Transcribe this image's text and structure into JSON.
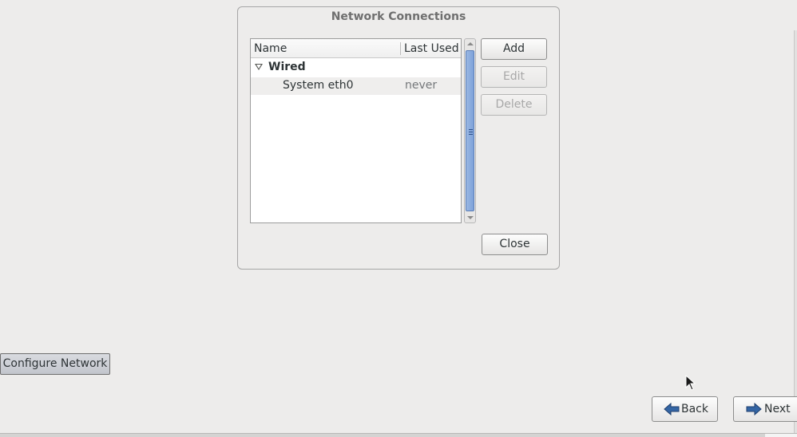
{
  "dialog": {
    "title": "Network Connections",
    "columns": {
      "name": "Name",
      "last_used": "Last Used"
    },
    "group": {
      "label": "Wired",
      "expanded": true
    },
    "connections": [
      {
        "name": "System eth0",
        "last_used": "never"
      }
    ],
    "buttons": {
      "add": "Add",
      "edit": "Edit",
      "delete": "Delete",
      "close": "Close"
    }
  },
  "configure_network_label": "Configure Network",
  "nav": {
    "back_label": "Back",
    "next_label": "Next"
  },
  "icons": {
    "expander": "triangle-down-icon",
    "back": "arrow-left-icon",
    "next": "arrow-right-icon",
    "cursor": "mouse-pointer-icon"
  },
  "colors": {
    "background": "#edeceb",
    "scroll_thumb": "#7ea2d9",
    "nav_arrow": "#3465a4"
  }
}
